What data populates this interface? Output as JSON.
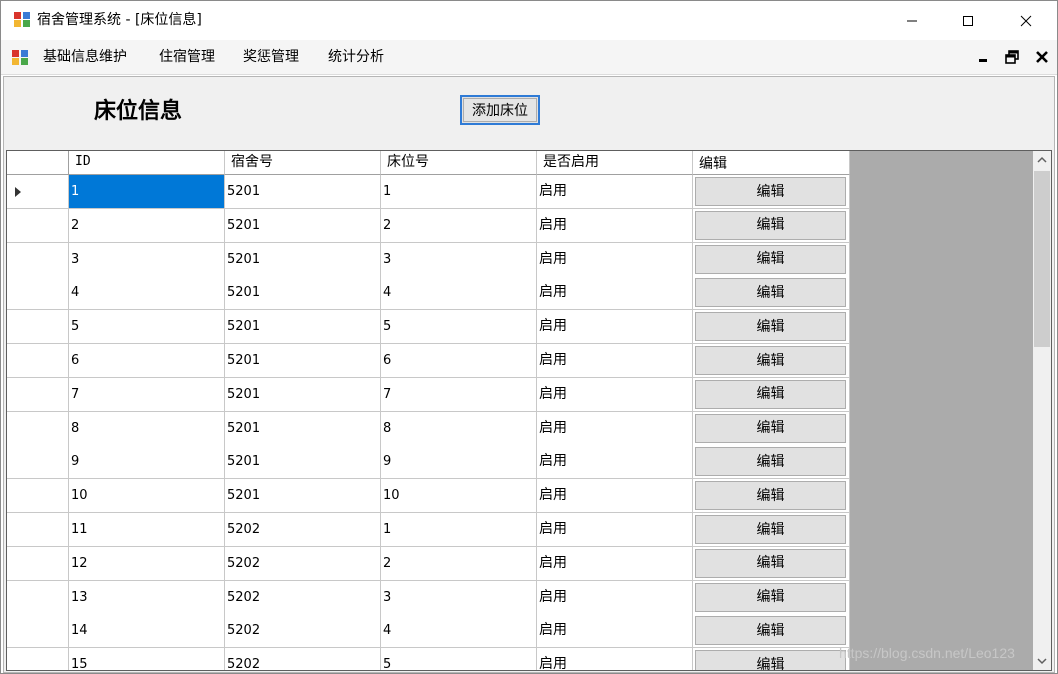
{
  "window": {
    "title": "宿舍管理系统 - [床位信息]"
  },
  "menu": {
    "items": [
      "基础信息维护",
      "住宿管理",
      "奖惩管理",
      "统计分析"
    ]
  },
  "page": {
    "title": "床位信息",
    "add_button_label": "添加床位"
  },
  "grid": {
    "columns": [
      "ID",
      "宿舍号",
      "床位号",
      "是否启用",
      "编辑"
    ],
    "edit_label": "编辑",
    "rows": [
      {
        "id": "1",
        "dorm": "5201",
        "bed": "1",
        "enabled": "启用"
      },
      {
        "id": "2",
        "dorm": "5201",
        "bed": "2",
        "enabled": "启用"
      },
      {
        "id": "3",
        "dorm": "5201",
        "bed": "3",
        "enabled": "启用"
      },
      {
        "id": "4",
        "dorm": "5201",
        "bed": "4",
        "enabled": "启用"
      },
      {
        "id": "5",
        "dorm": "5201",
        "bed": "5",
        "enabled": "启用"
      },
      {
        "id": "6",
        "dorm": "5201",
        "bed": "6",
        "enabled": "启用"
      },
      {
        "id": "7",
        "dorm": "5201",
        "bed": "7",
        "enabled": "启用"
      },
      {
        "id": "8",
        "dorm": "5201",
        "bed": "8",
        "enabled": "启用"
      },
      {
        "id": "9",
        "dorm": "5201",
        "bed": "9",
        "enabled": "启用"
      },
      {
        "id": "10",
        "dorm": "5201",
        "bed": "10",
        "enabled": "启用"
      },
      {
        "id": "11",
        "dorm": "5202",
        "bed": "1",
        "enabled": "启用"
      },
      {
        "id": "12",
        "dorm": "5202",
        "bed": "2",
        "enabled": "启用"
      },
      {
        "id": "13",
        "dorm": "5202",
        "bed": "3",
        "enabled": "启用"
      },
      {
        "id": "14",
        "dorm": "5202",
        "bed": "4",
        "enabled": "启用"
      },
      {
        "id": "15",
        "dorm": "5202",
        "bed": "5",
        "enabled": "启用"
      }
    ],
    "selected_row": 0
  },
  "watermark": "https://blog.csdn.net/Leo123",
  "colors": {
    "selection": "#0078d7",
    "focus_border": "#2f7bd6",
    "grid_background": "#ababab"
  }
}
